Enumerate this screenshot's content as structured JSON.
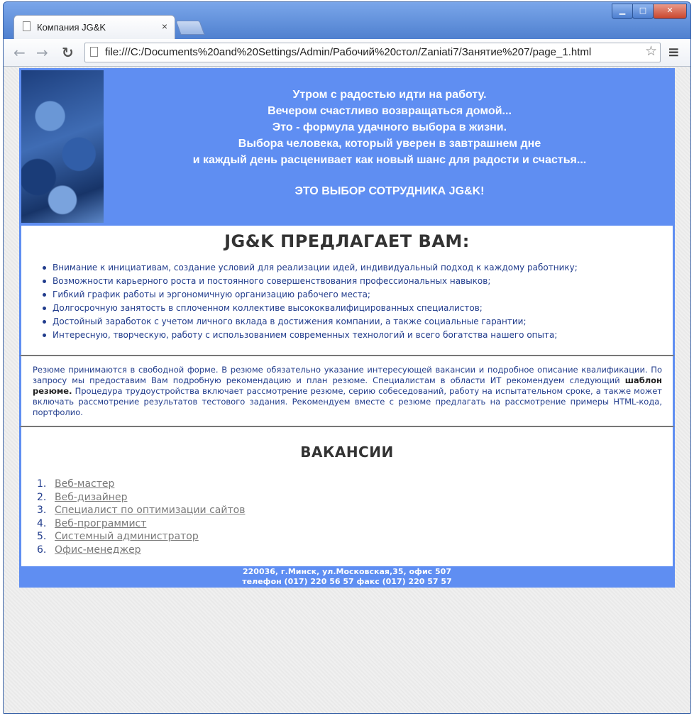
{
  "browser": {
    "tab_title": "Компания JG&K",
    "tab_close": "×",
    "url": "file:///C:/Documents%20and%20Settings/Admin/Рабочий%20стол/Zaniati7/Занятие%207/page_1.html",
    "window_controls": {
      "minimize": "▁",
      "maximize": "□",
      "close": "✕"
    },
    "icons": {
      "back": "arrow-left-icon",
      "forward": "arrow-right-icon",
      "reload": "reload-icon",
      "star": "star-icon",
      "menu": "menu-icon"
    }
  },
  "banner": {
    "lines": [
      "Утром с радостью идти на работу.",
      "Вечером счастливо возвращаться домой...",
      "Это - формула удачного выбора в жизни.",
      "Выбора человека, который уверен в завтрашнем дне",
      "и каждый день расценивает как новый шанс для радости и счастья..."
    ],
    "main": "ЭТО ВЫБОР СОТРУДНИКА JG&K!"
  },
  "offer": {
    "title": "JG&K ПРЕДЛАГАЕТ ВАМ:",
    "items": [
      "Внимание к инициативам, создание условий для реализации идей, индивидуальный подход к каждому работнику;",
      "Возможности карьерного роста и постоянного совершенствования профессиональных навыков;",
      "Гибкий график работы и эргономичную организацию рабочего места;",
      "Долгосрочную занятость в сплоченном коллективе высококвалифицированных специалистов;",
      "Достойный заработок с учетом личного вклада в достижения компании, а также социальные гарантии;",
      "Интересную, творческую, работу с использованием современных технологий и всего богатства нашего опыта;"
    ]
  },
  "resume": {
    "text_before": "Резюме принимаются в свободной форме. В резюме обязательно указание интересующей вакансии и подробное описание квалификации. По запросу мы предоставим Вам подробную рекомендацию и план резюме. Специалистам в области ИТ рекомендуем следующий ",
    "link": "шаблон резюме.",
    "text_after": " Процедура трудоустройства включает рассмотрение резюме, серию собеседований, работу на испытательном сроке, а также может включать рассмотрение результатов тестового задания. Рекомендуем вместе с резюме предлагать на рассмотрение примеры HTML-кода, портфолио."
  },
  "vacancies": {
    "title": "ВАКАНСИИ",
    "items": [
      {
        "num": "1.",
        "label": "Веб-мастер"
      },
      {
        "num": "2.",
        "label": "Веб-дизайнер"
      },
      {
        "num": "3.",
        "label": "Специалист по оптимизации сайтов"
      },
      {
        "num": "4.",
        "label": "Веб-программист"
      },
      {
        "num": "5.",
        "label": "Системный администратор"
      },
      {
        "num": "6.",
        "label": "Офис-менеджер"
      }
    ]
  },
  "footer": {
    "address": "220036, г.Минск, ул.Московская,35, офис 507",
    "phone": "телефон (017) 220 56 57 факс (017) 220 57 57"
  }
}
